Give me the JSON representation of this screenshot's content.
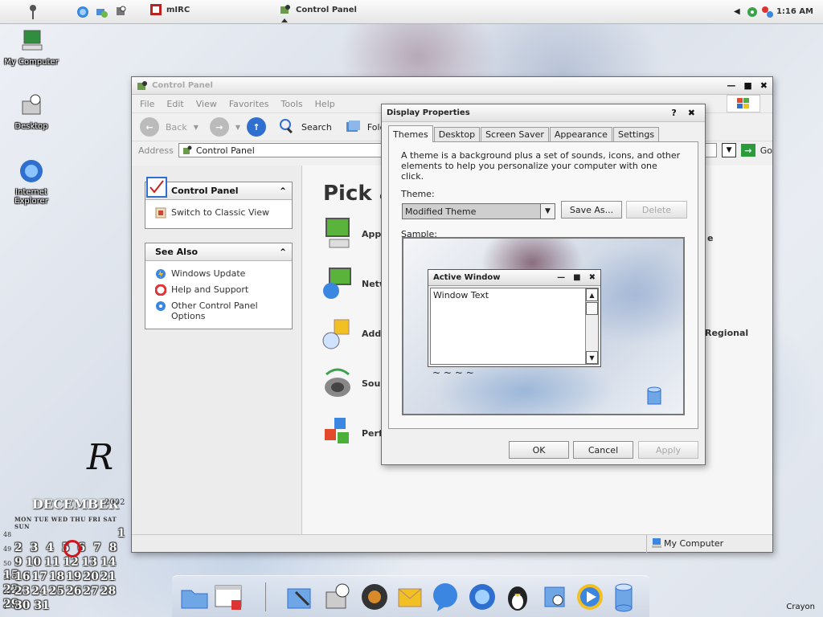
{
  "taskbar": {
    "items": [
      {
        "label": "mIRC"
      },
      {
        "label": "Control Panel"
      }
    ],
    "clock": "1:16 AM"
  },
  "desktop_icons": [
    {
      "label": "My Computer"
    },
    {
      "label": "Desktop"
    },
    {
      "label": "Internet Explorer"
    }
  ],
  "control_panel": {
    "title": "Control Panel",
    "menu": [
      "File",
      "Edit",
      "View",
      "Favorites",
      "Tools",
      "Help"
    ],
    "toolbar": {
      "back": "Back",
      "search": "Search",
      "folders": "Folders"
    },
    "address_label": "Address",
    "address_value": "Control Panel",
    "go_label": "Go",
    "tasks_panel": {
      "title": "Control Panel",
      "link": "Switch to Classic View"
    },
    "see_also": {
      "title": "See Also",
      "links": [
        "Windows Update",
        "Help and Support",
        "Other Control Panel Options"
      ]
    },
    "heading": "Pick a",
    "categories": [
      "App",
      "Netw",
      "Add",
      "Sou",
      "Perf"
    ],
    "right_fragments": [
      "e",
      "Regional"
    ],
    "status": "My Computer"
  },
  "display_properties": {
    "title": "Display Properties",
    "tabs": [
      "Themes",
      "Desktop",
      "Screen Saver",
      "Appearance",
      "Settings"
    ],
    "active_tab": "Themes",
    "description": "A theme is a background plus a set of sounds, icons, and other elements to help you personalize your computer with one click.",
    "theme_label": "Theme:",
    "theme_value": "Modified Theme",
    "save_as": "Save As...",
    "delete": "Delete",
    "sample_label": "Sample:",
    "sample_window": {
      "title": "Active Window",
      "text": "Window Text"
    },
    "ok": "OK",
    "cancel": "Cancel",
    "apply": "Apply"
  },
  "calendar": {
    "month": "DECEMBER",
    "year": "2002",
    "weekdays": "MON TUE WED THU FRI SAT SUN",
    "weeks": [
      {
        "num": "48",
        "days": "1"
      },
      {
        "num": "49",
        "days": "2 3 4 5 6 7 8"
      },
      {
        "num": "50",
        "days": "9 10 11 12 13 14 15"
      },
      {
        "num": "51",
        "days": "16 17 18 19 20 21 22"
      },
      {
        "num": "52",
        "days": "23 24 25 26 27 28 29"
      },
      {
        "num": "1",
        "days": "30 31"
      }
    ],
    "today": "5"
  },
  "signature": "Crayon",
  "colors": {
    "accent_blue": "#2f6fd0",
    "go_green": "#2a9a3a",
    "today_red": "#d0141b"
  }
}
